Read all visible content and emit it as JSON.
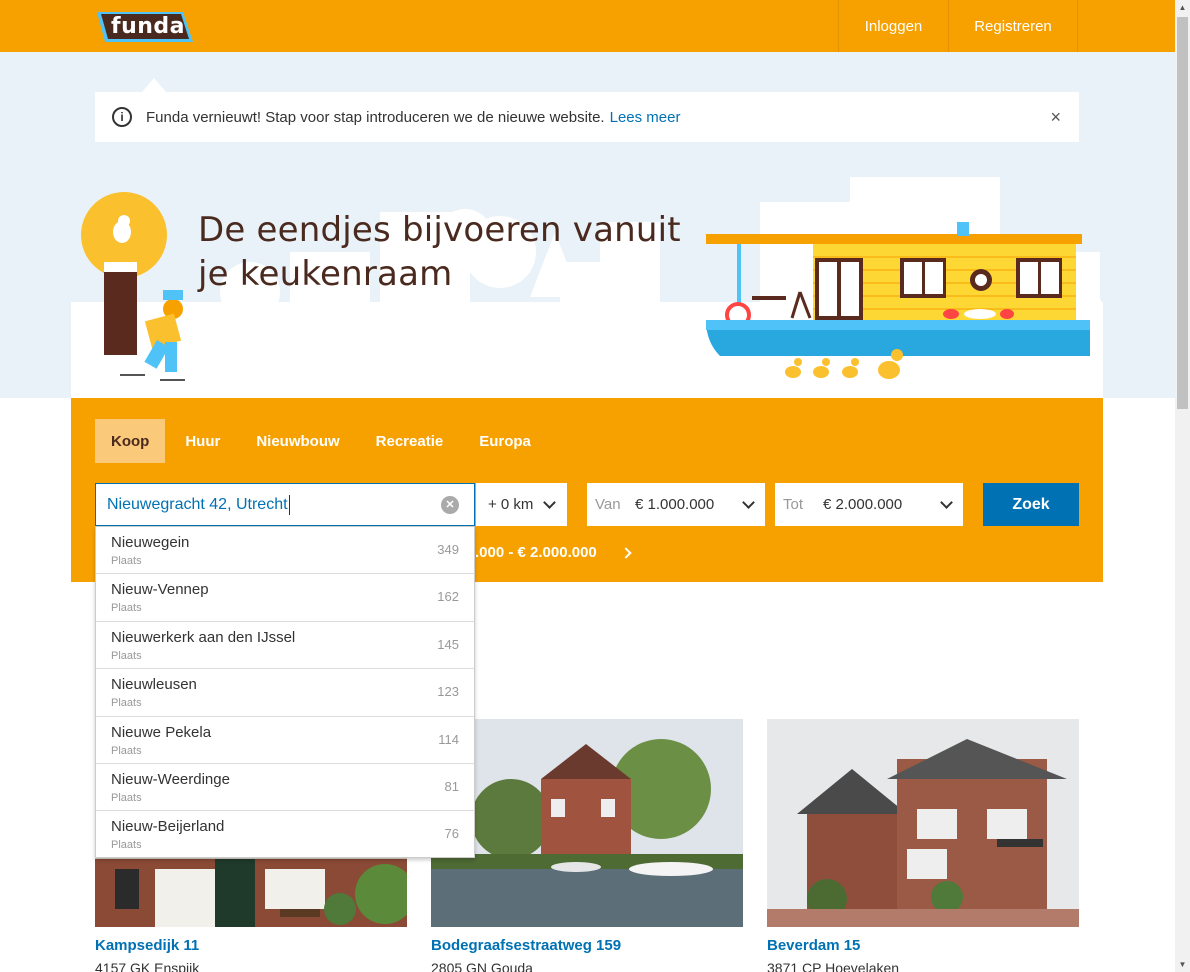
{
  "header": {
    "logo_text": "funda",
    "login": "Inloggen",
    "register": "Registreren",
    "brand_color": "#f7a100"
  },
  "notice": {
    "icon": "info-icon",
    "text": "Funda vernieuwt! Stap voor stap introduceren we de nieuwe website.",
    "link": "Lees meer",
    "close": "×"
  },
  "hero": {
    "title": "De eendjes bijvoeren vanuit je keukenraam"
  },
  "search": {
    "tabs": [
      {
        "label": "Koop",
        "active": true
      },
      {
        "label": "Huur",
        "active": false
      },
      {
        "label": "Nieuwbouw",
        "active": false
      },
      {
        "label": "Recreatie",
        "active": false
      },
      {
        "label": "Europa",
        "active": false
      }
    ],
    "query": "Nieuwegracht 42, Utrecht",
    "radius": "+ 0 km",
    "price_from_label": "Van",
    "price_from": "€ 1.000.000",
    "price_to_label": "Tot",
    "price_to": "€ 2.000.000",
    "submit": "Zoek",
    "price_summary_visible": ".000 - € 2.000.000",
    "accent_color": "#0071b3"
  },
  "suggestions": [
    {
      "name": "Nieuwegein",
      "type": "Plaats",
      "count": "349"
    },
    {
      "name": "Nieuw-Vennep",
      "type": "Plaats",
      "count": "162"
    },
    {
      "name": "Nieuwerkerk aan den IJssel",
      "type": "Plaats",
      "count": "145"
    },
    {
      "name": "Nieuwleusen",
      "type": "Plaats",
      "count": "123"
    },
    {
      "name": "Nieuwe Pekela",
      "type": "Plaats",
      "count": "114"
    },
    {
      "name": "Nieuw-Weerdinge",
      "type": "Plaats",
      "count": "81"
    },
    {
      "name": "Nieuw-Beijerland",
      "type": "Plaats",
      "count": "76"
    }
  ],
  "listings": [
    {
      "title": "Kampsedijk 11",
      "subtitle": "4157 GK Enspijk"
    },
    {
      "title": "Bodegraafsestraatweg 159",
      "subtitle": "2805 GN Gouda"
    },
    {
      "title": "Beverdam 15",
      "subtitle": "3871 CP Hoevelaken"
    }
  ]
}
